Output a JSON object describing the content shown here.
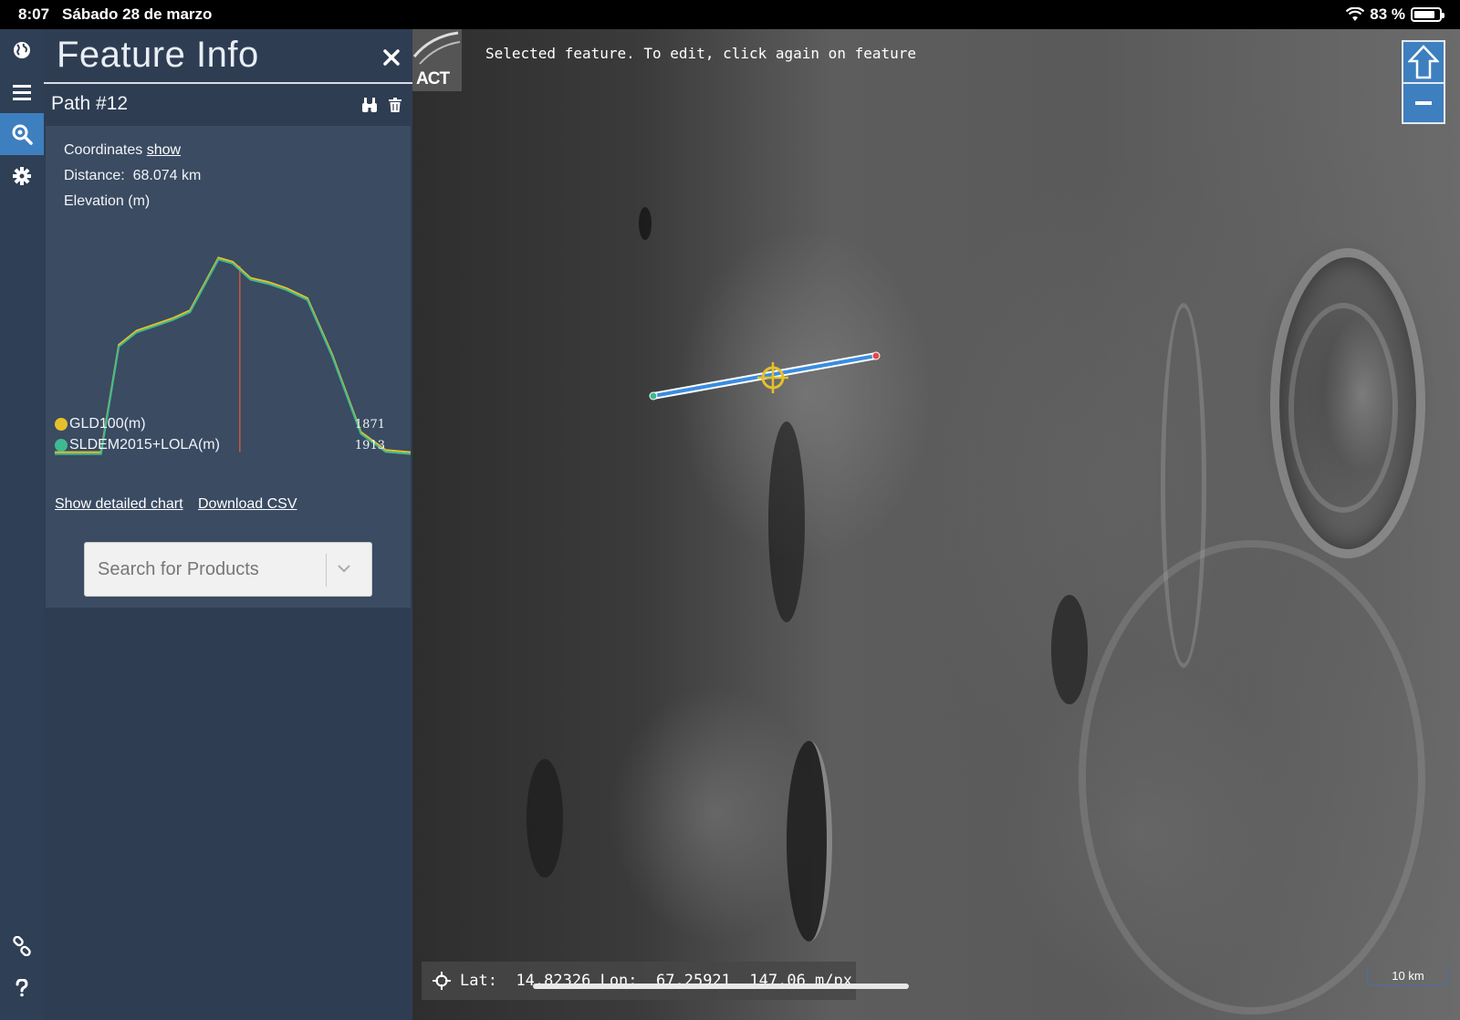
{
  "status_bar": {
    "time": "8:07",
    "date": "Sábado 28 de marzo",
    "battery": "83 %",
    "battery_level": 0.83
  },
  "panel": {
    "title": "Feature Info",
    "path_title": "Path #12",
    "coordinates_label": "Coordinates",
    "coordinates_link": "show",
    "distance_label": "Distance:",
    "distance_value": "68.074 km",
    "elevation_label": "Elevation (m)",
    "legend": [
      {
        "name": "GLD100(m)",
        "value": "1871",
        "color": "#e5c02b"
      },
      {
        "name": "SLDEM2015+LOLA(m)",
        "value": "1913",
        "color": "#3fb98f"
      }
    ],
    "show_chart_link": "Show detailed chart",
    "download_csv_link": "Download CSV",
    "search_placeholder": "Search for Products"
  },
  "chart_data": {
    "type": "line",
    "series": [
      {
        "name": "GLD100(m)",
        "color": "#e5c02b"
      },
      {
        "name": "SLDEM2015+LOLA(m)",
        "color": "#3fb98f"
      }
    ],
    "x": [
      0,
      0.05,
      0.13,
      0.18,
      0.23,
      0.28,
      0.33,
      0.38,
      0.42,
      0.46,
      0.5,
      0.55,
      0.6,
      0.65,
      0.71,
      0.78,
      0.86,
      0.93,
      1.0
    ],
    "y_norm": [
      0.02,
      0.02,
      0.02,
      0.55,
      0.62,
      0.65,
      0.68,
      0.72,
      0.85,
      0.98,
      0.96,
      0.88,
      0.86,
      0.83,
      0.78,
      0.5,
      0.12,
      0.03,
      0.02
    ],
    "cursor_x": 0.52,
    "cursor_color": "#c85a3a",
    "grid": false
  },
  "map": {
    "toast": "Selected feature. To edit, click again on feature",
    "logo_text": "ACT",
    "lat_label": "Lat:",
    "lat_value": "14.82326",
    "lon_label": "Lon:",
    "lon_value": "67.25921",
    "resolution": "147.06 m/px",
    "scale_label": "10 km",
    "path_color": "#3a8de0"
  }
}
